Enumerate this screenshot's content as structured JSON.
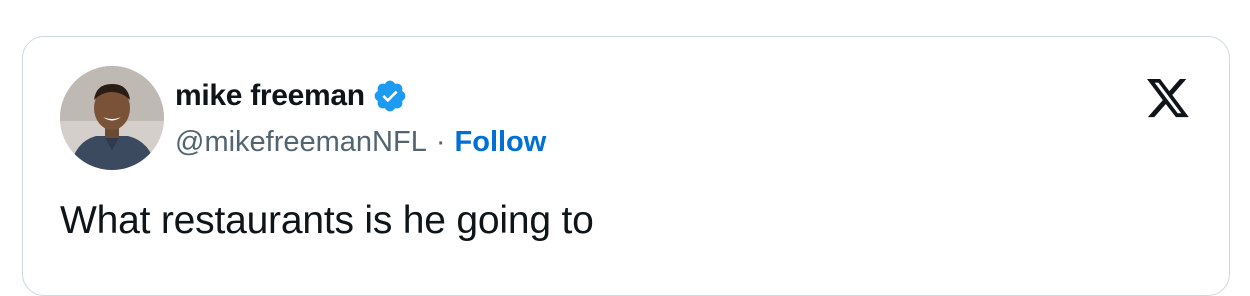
{
  "embed": {
    "author": {
      "display_name": "mike freeman",
      "handle": "@mikefreemanNFL",
      "separator": "·",
      "follow_label": "Follow",
      "verified": true,
      "verified_color": "#1d9bf0"
    },
    "platform_icon": "x-logo-icon",
    "tweet_text": "What restaurants is he going to",
    "colors": {
      "text": "#0f1419",
      "secondary": "#536471",
      "link": "#006fd6",
      "border": "#cfd9de"
    }
  }
}
